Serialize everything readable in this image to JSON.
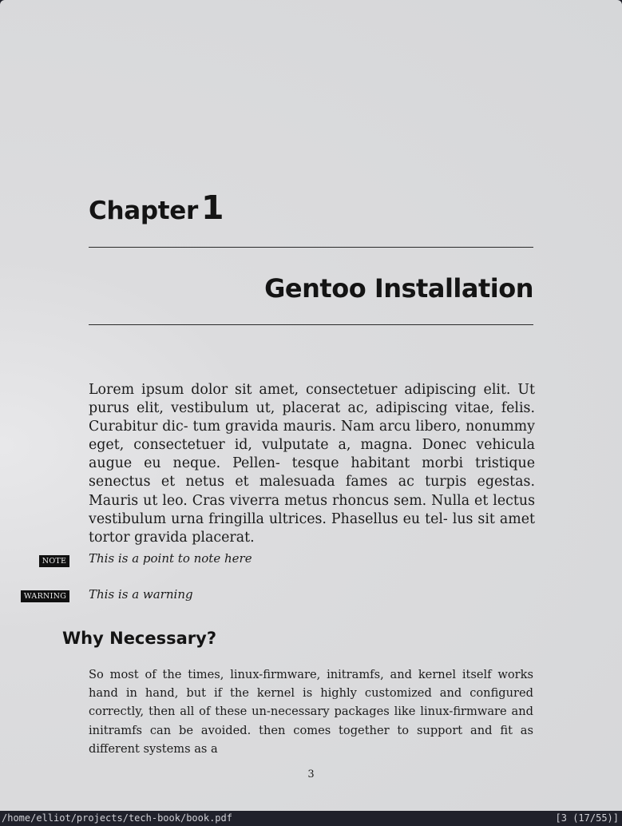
{
  "document": {
    "chapter_word": "Chapter",
    "chapter_number": "1",
    "chapter_title": "Gentoo Installation",
    "body_paragraph": "Lorem ipsum dolor sit amet, consectetuer adipiscing elit. Ut purus elit, vestibulum ut, placerat ac, adipiscing vitae, felis. Curabitur dic- tum gravida mauris. Nam arcu libero, nonummy eget, consectetuer id, vulputate a, magna. Donec vehicula augue eu neque. Pellen- tesque habitant morbi tristique senectus et netus et malesuada fames ac turpis egestas. Mauris ut leo. Cras viverra metus rhoncus sem. Nulla et lectus vestibulum urna fringilla ultrices. Phasellus eu tel- lus sit amet tortor gravida placerat.",
    "callouts": [
      {
        "badge": "NOTE",
        "text": "This is a point to note here"
      },
      {
        "badge": "WARNING",
        "text": "This is a warning"
      }
    ],
    "section_heading": "Why Necessary?",
    "section_paragraph": "So most of the times, linux-firmware, initramfs, and kernel itself works hand in hand, but if the kernel is highly customized and configured correctly, then all of these un-necessary packages like linux-firmware and initramfs can be avoided.  then comes together to support and fit as different systems as a",
    "page_number": "3"
  },
  "statusbar": {
    "file_path": "/home/elliot/projects/tech-book/book.pdf",
    "page_indicator": "[3 (17/55)]"
  },
  "colors": {
    "page_background": "#d9dadc",
    "statusbar_background": "#20212b",
    "badge_background": "#111111"
  }
}
